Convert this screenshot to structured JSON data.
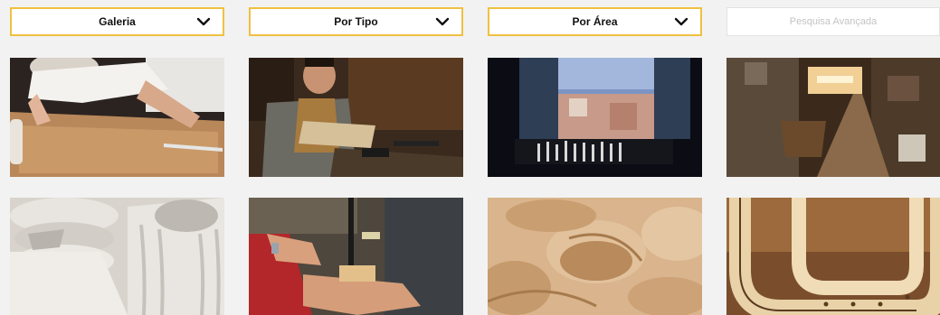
{
  "filters": {
    "galeria_label": "Galeria",
    "tipo_label": "Por Tipo",
    "area_label": "Por Área",
    "advanced_label": "Pesquisa Avançada"
  },
  "colors": {
    "filter_border": "#f0c040",
    "background": "#f2f2f2"
  },
  "icons": {
    "dropdown": "chevron-down-icon"
  }
}
